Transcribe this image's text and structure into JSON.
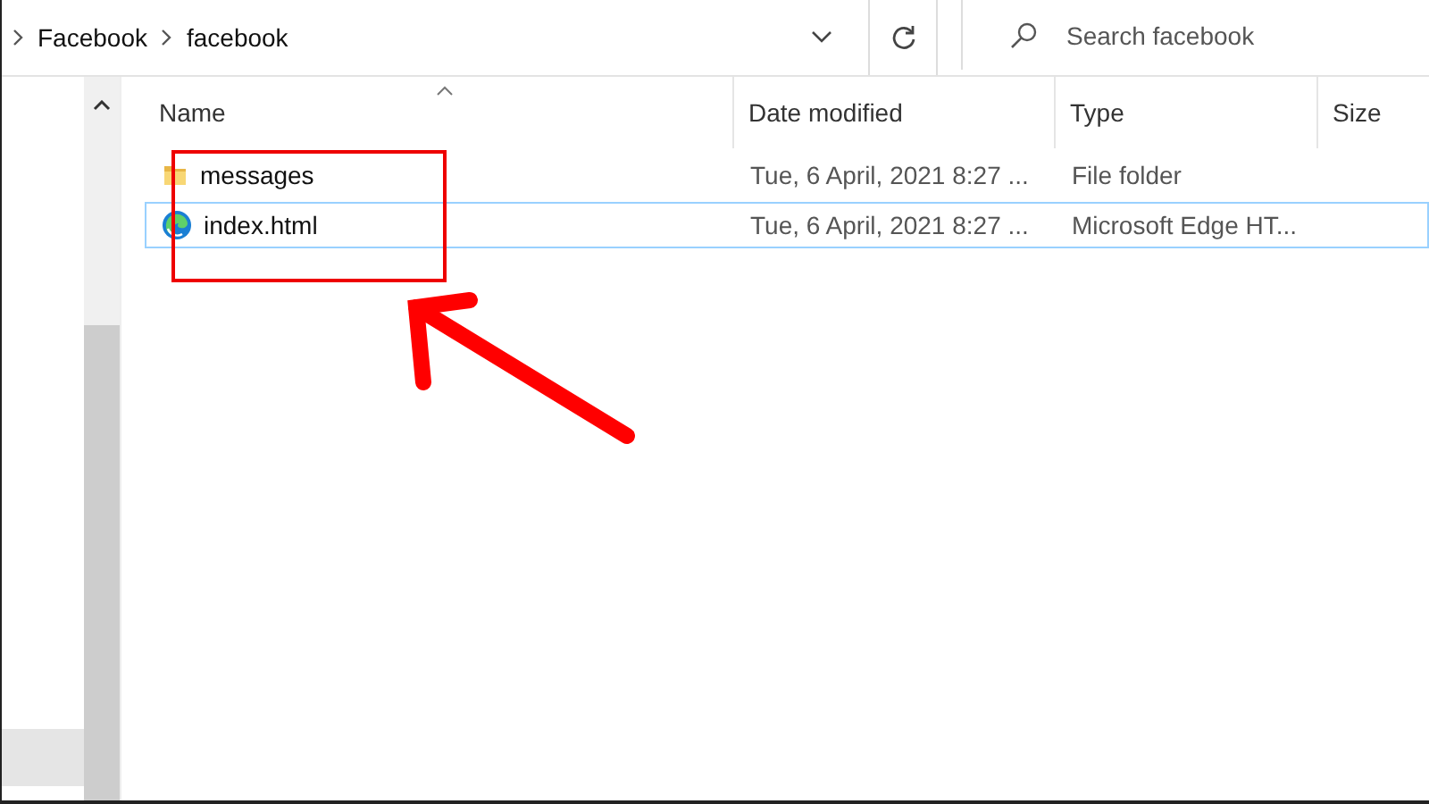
{
  "address_bar": {
    "crumbs": [
      "Facebook",
      "facebook"
    ]
  },
  "search": {
    "placeholder": "Search facebook"
  },
  "table": {
    "columns": [
      "Name",
      "Date modified",
      "Type",
      "Size"
    ],
    "rows": [
      {
        "kind": "folder",
        "name": "messages",
        "date": "Tue, 6 April, 2021 8:27 ...",
        "type": "File folder",
        "selected": false
      },
      {
        "kind": "edge",
        "name": "index.html",
        "date": "Tue, 6 April, 2021 8:27 ...",
        "type": "Microsoft Edge HT...",
        "selected": true
      }
    ]
  }
}
